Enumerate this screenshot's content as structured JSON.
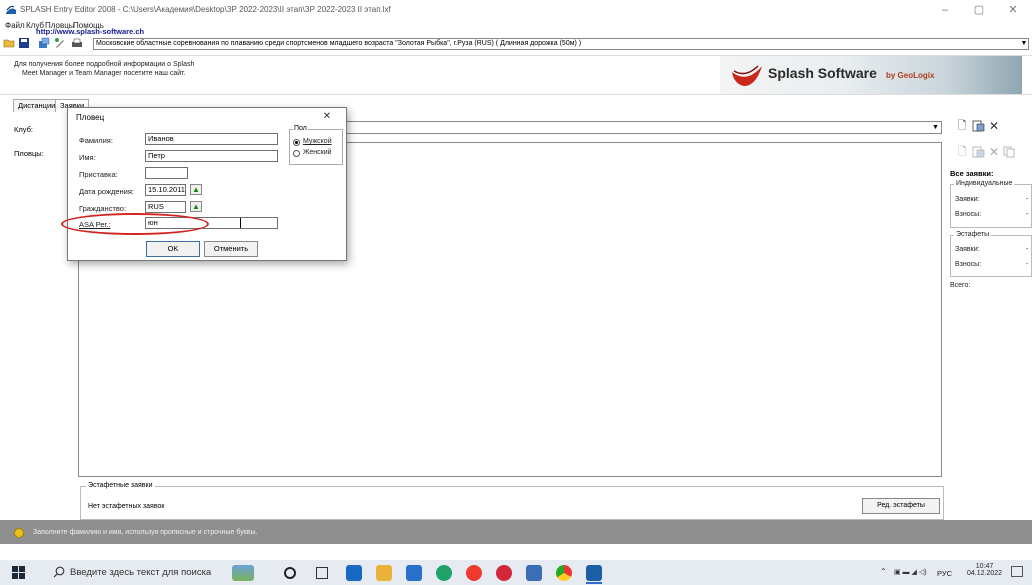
{
  "window": {
    "title": "SPLASH Entry Editor 2008 - C:\\Users\\Академия\\Desktop\\ЗР 2022-2023\\II этап\\ЗР 2022-2023 II этап.lxf",
    "minimize": "–",
    "maximize": "▢",
    "close": "✕"
  },
  "menu": [
    "Файл",
    "Клуб",
    "Пловцы",
    "Помощь"
  ],
  "meet": {
    "selected": "Московские областные соревнования по плаванию среди спортсменов младшего возраста \"Золотая Рыбка\", г.Руза (RUS) ( Длинная дорожка (50м) )"
  },
  "info": {
    "line1": "Для получения более подробной информации о Splash",
    "line2": "Meet Manager и Team Manager посетите наш сайт.",
    "link": "http://www.splash-software.ch"
  },
  "banner": {
    "brand": "Splash Software",
    "by": "by GeoLogix"
  },
  "tabs": [
    "Дистанции",
    "Заявки"
  ],
  "form": {
    "club_label": "Клуб:",
    "swimmers_label": "Пловцы:"
  },
  "right_panel": {
    "all_entries": "Все заявки:",
    "individual_title": "Индивидуальные",
    "entries": "Заявки:",
    "fees": "Взносы:",
    "relays_title": "Эстафеты",
    "total": "Всего:",
    "dash": "-"
  },
  "relay": {
    "title": "Эстафетные заявки",
    "none": "Нет эстафетных заявок",
    "button": "Ред. эстафеты"
  },
  "status": "Заполните фамилию и имя, используя прописные и строчные буквы.",
  "taskbar": {
    "search": "Введите здесь текст для поиска",
    "lang": "РУС",
    "time": "10:47",
    "date": "04.12.2022"
  },
  "dialog": {
    "title": "Пловец",
    "close": "✕",
    "last_name_label": "Фамилия:",
    "last_name": "Иванов",
    "first_name_label": "Имя:",
    "first_name": "Петр",
    "prefix_label": "Приставка:",
    "prefix": "",
    "dob_label": "Дата рождения:",
    "dob": "15.10.2011",
    "nation_label": "Гражданство:",
    "nation": "RUS",
    "asa_label": "ASA Рег.:",
    "asa": "юн",
    "gender_title": "Пол",
    "gender_male": "Мужской",
    "gender_female": "Женский",
    "gender_selected": "male",
    "ok": "OK",
    "cancel": "Отменить"
  },
  "colors": {
    "status_bar": "#8f8f8f",
    "taskbar": "#e6ebf1",
    "highlight": "#d42222",
    "link": "#1a1a8e"
  }
}
